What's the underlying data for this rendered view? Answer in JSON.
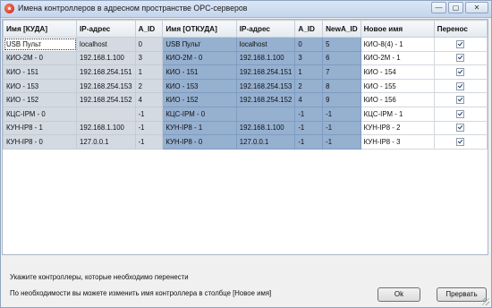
{
  "window": {
    "title": "Имена контроллеров в адресном пространстве OPC-серверов"
  },
  "window_controls": {
    "minimize": "—",
    "maximize": "▢",
    "close": "✕"
  },
  "grid": {
    "headers": [
      "Имя [КУДА]",
      "IP-адрес",
      "A_ID",
      "Имя [ОТКУДА]",
      "IP-адрес",
      "A_ID",
      "NewA_ID",
      "Новое имя",
      "Перенос"
    ],
    "rows": [
      [
        "USB Пульт",
        "localhost",
        "0",
        "USB Пульт",
        "localhost",
        "0",
        "5",
        "КИО-8(4) - 1",
        "✓"
      ],
      [
        "КИО-2М - 0",
        "192.168.1.100",
        "3",
        "КИО-2М - 0",
        "192.168.1.100",
        "3",
        "6",
        "КИО-2М - 1",
        "✓"
      ],
      [
        "КИО - 151",
        "192.168.254.151",
        "1",
        "КИО - 151",
        "192.168.254.151",
        "1",
        "7",
        "КИО - 154",
        "✓"
      ],
      [
        "КИО - 153",
        "192.168.254.153",
        "2",
        "КИО - 153",
        "192.168.254.153",
        "2",
        "8",
        "КИО - 155",
        "✓"
      ],
      [
        "КИО - 152",
        "192.168.254.152",
        "4",
        "КИО - 152",
        "192.168.254.152",
        "4",
        "9",
        "КИО - 156",
        "✓"
      ],
      [
        "КЦС-IPM - 0",
        "",
        "-1",
        "КЦС-IPM - 0",
        "",
        "-1",
        "-1",
        "КЦС-IPM - 1",
        "✓"
      ],
      [
        "КУН-IP8 - 1",
        "192.168.1.100",
        "-1",
        "КУН-IP8 - 1",
        "192.168.1.100",
        "-1",
        "-1",
        "КУН-IP8 - 2",
        "✓"
      ],
      [
        "КУН-IP8 - 0",
        "127.0.0.1",
        "-1",
        "КУН-IP8 - 0",
        "127.0.0.1",
        "-1",
        "-1",
        "КУН-IP8 - 3",
        "✓"
      ]
    ]
  },
  "footer": {
    "hint1": "Укажите контроллеры, которые необходимо перенести",
    "hint2": "По необходимости вы можете изменить имя контроллера в столбце [Новое имя]",
    "ok_label": "Ok",
    "abort_label": "Прервать"
  }
}
